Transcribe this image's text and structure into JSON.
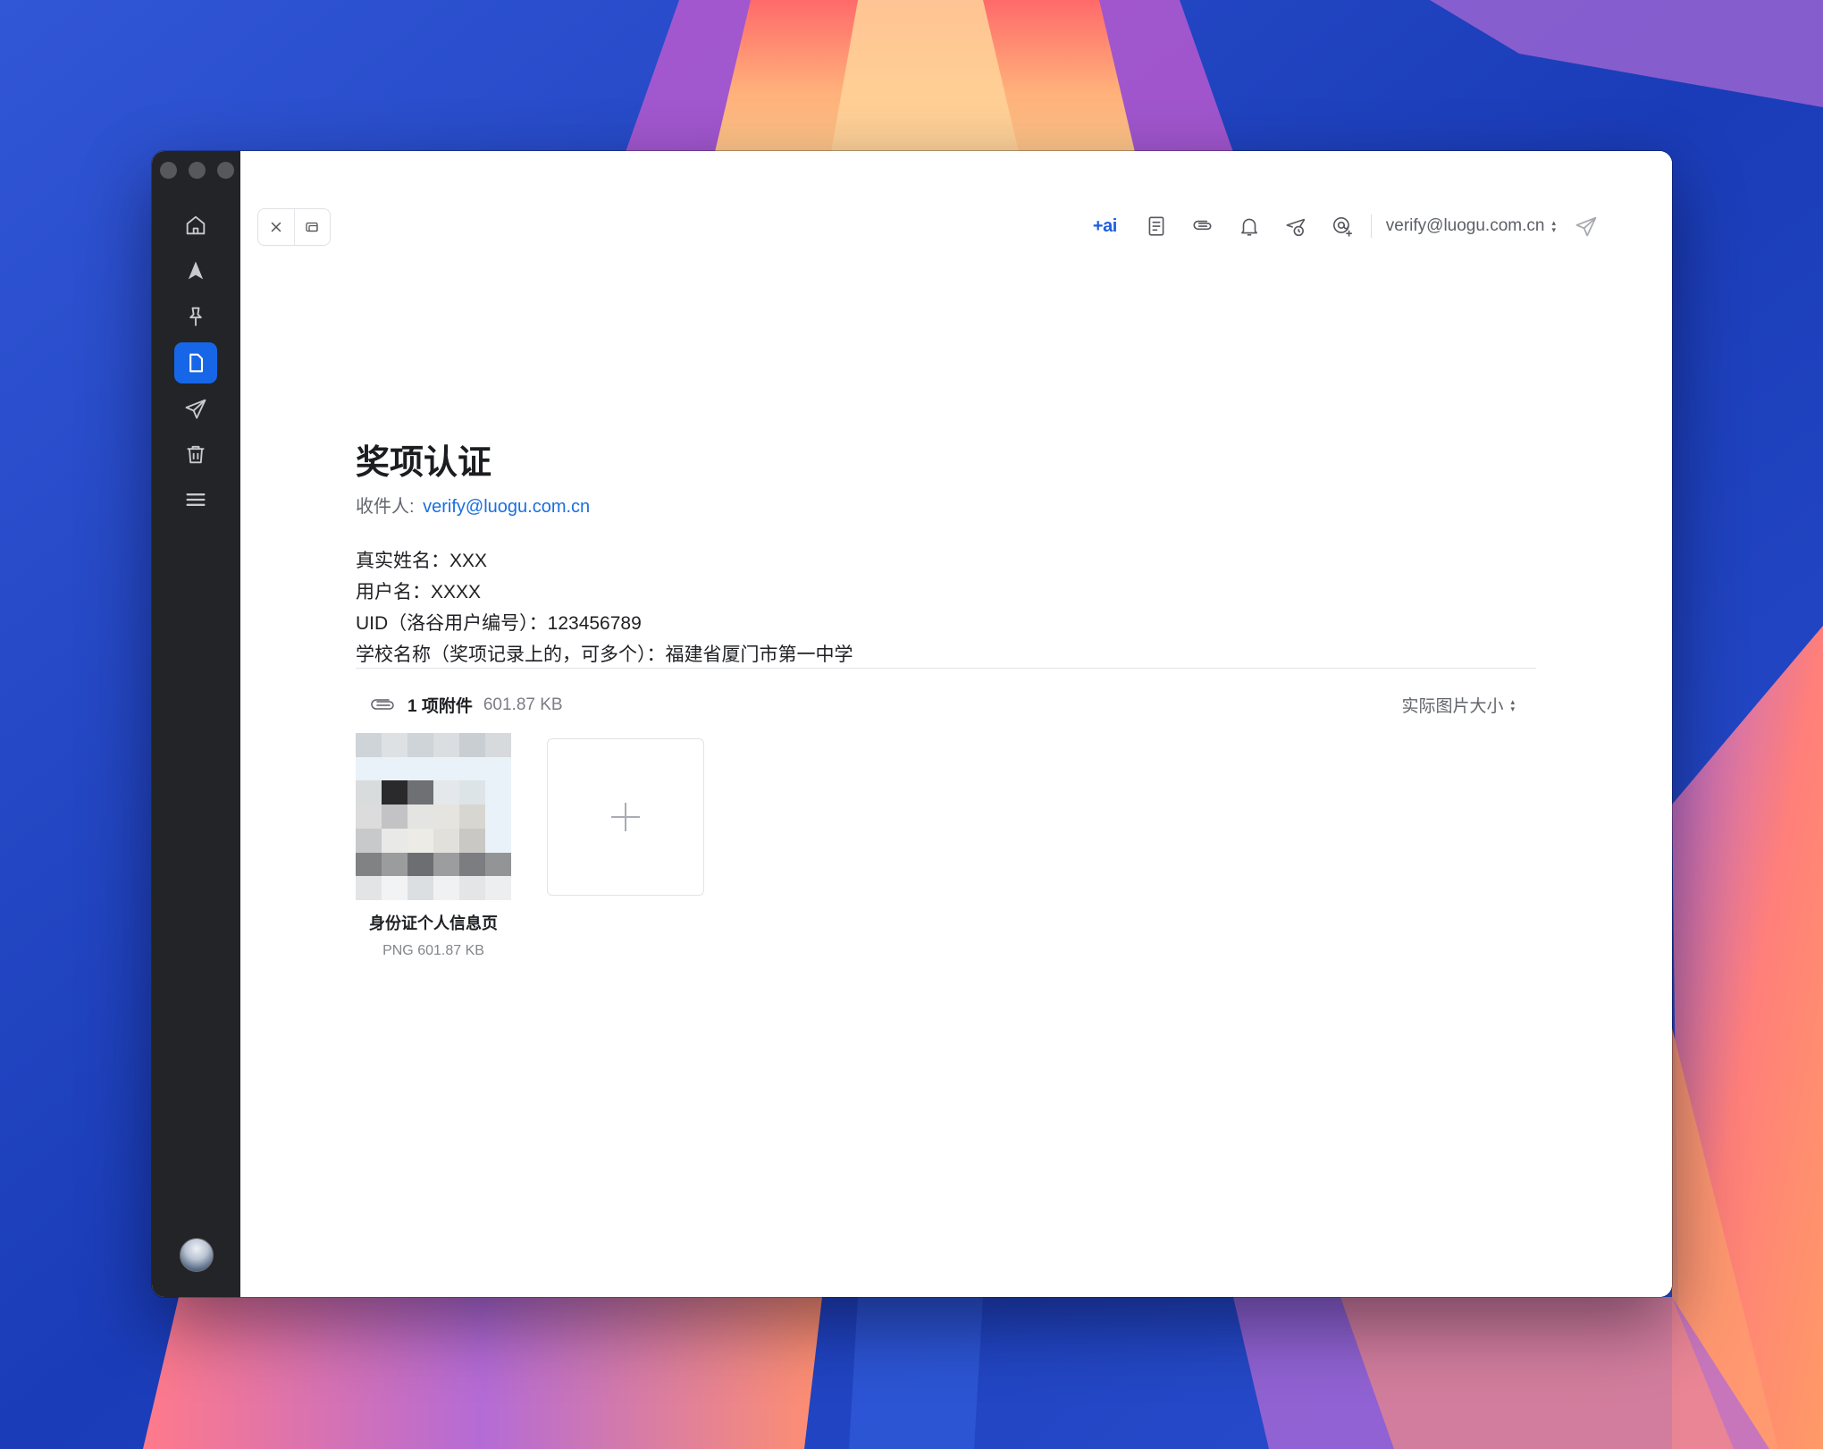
{
  "sidebar": {
    "items": [
      {
        "name": "home",
        "icon": "home-icon",
        "active": false
      },
      {
        "name": "navigate",
        "icon": "navigation-arrow-icon",
        "active": false
      },
      {
        "name": "pinned",
        "icon": "pin-icon",
        "active": false
      },
      {
        "name": "drafts",
        "icon": "document-icon",
        "active": true
      },
      {
        "name": "sent",
        "icon": "paper-plane-icon",
        "active": false
      },
      {
        "name": "trash",
        "icon": "trash-icon",
        "active": false
      },
      {
        "name": "menu",
        "icon": "hamburger-menu-icon",
        "active": false
      }
    ],
    "accent": "#1766e8"
  },
  "toolbar": {
    "ai_label": "+ai",
    "icons": [
      "notes-icon",
      "paperclip-icon",
      "bell-icon",
      "send-later-icon",
      "mention-icon",
      "send-icon"
    ],
    "account": "verify@luogu.com.cn"
  },
  "email": {
    "subject": "奖项认证",
    "to_label": "收件人:",
    "to_address": "verify@luogu.com.cn",
    "body_lines": [
      "真实姓名：XXX",
      "用户名：XXXX",
      "UID（洛谷用户编号）：123456789",
      "学校名称（奖项记录上的，可多个）：福建省厦门市第一中学"
    ]
  },
  "attachments": {
    "count_label": "1 项附件",
    "total_size": "601.87 KB",
    "size_mode": "实际图片大小",
    "items": [
      {
        "name": "身份证个人信息页",
        "meta": "PNG 601.87 KB"
      }
    ]
  }
}
